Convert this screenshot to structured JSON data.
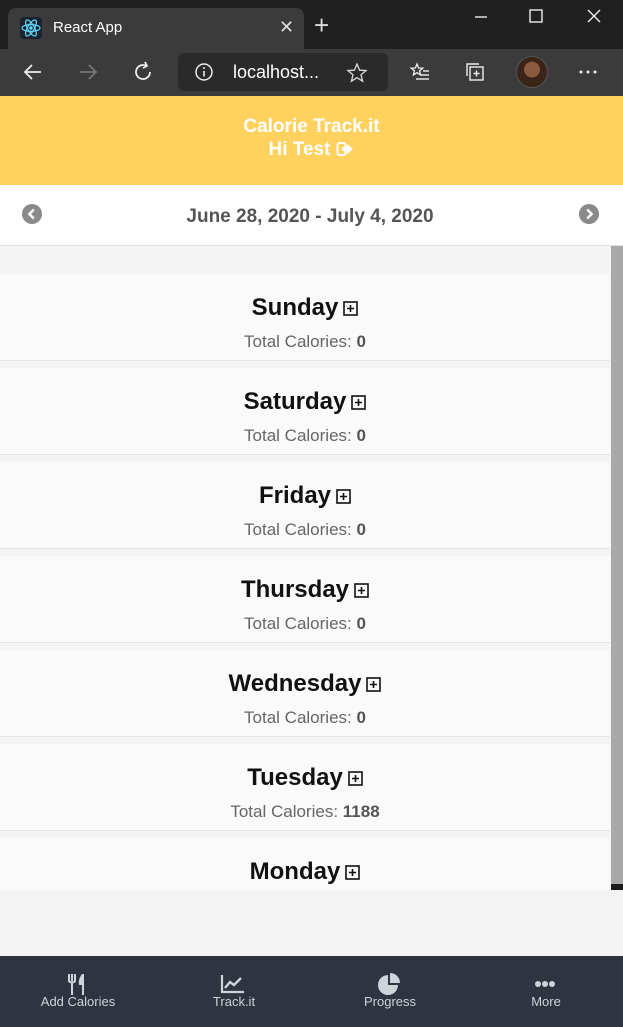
{
  "browser": {
    "tab_title": "React App",
    "url": "localhost..."
  },
  "app": {
    "title": "Calorie Track.it",
    "greeting": "Hi Test"
  },
  "week": {
    "range": "June 28, 2020 - July 4, 2020"
  },
  "total_label": "Total Calories:",
  "days": [
    {
      "name": "Sunday",
      "total": "0"
    },
    {
      "name": "Saturday",
      "total": "0"
    },
    {
      "name": "Friday",
      "total": "0"
    },
    {
      "name": "Thursday",
      "total": "0"
    },
    {
      "name": "Wednesday",
      "total": "0"
    },
    {
      "name": "Tuesday",
      "total": "1188"
    },
    {
      "name": "Monday",
      "total": ""
    }
  ],
  "bottom_nav": [
    {
      "label": "Add Calories",
      "icon": "utensils-icon"
    },
    {
      "label": "Track.it",
      "icon": "chart-line-icon"
    },
    {
      "label": "Progress",
      "icon": "pie-chart-icon"
    },
    {
      "label": "More",
      "icon": "more-dots-icon"
    }
  ],
  "colors": {
    "header_bg": "#ffd15f",
    "bottom_nav_bg": "#2e3440"
  }
}
